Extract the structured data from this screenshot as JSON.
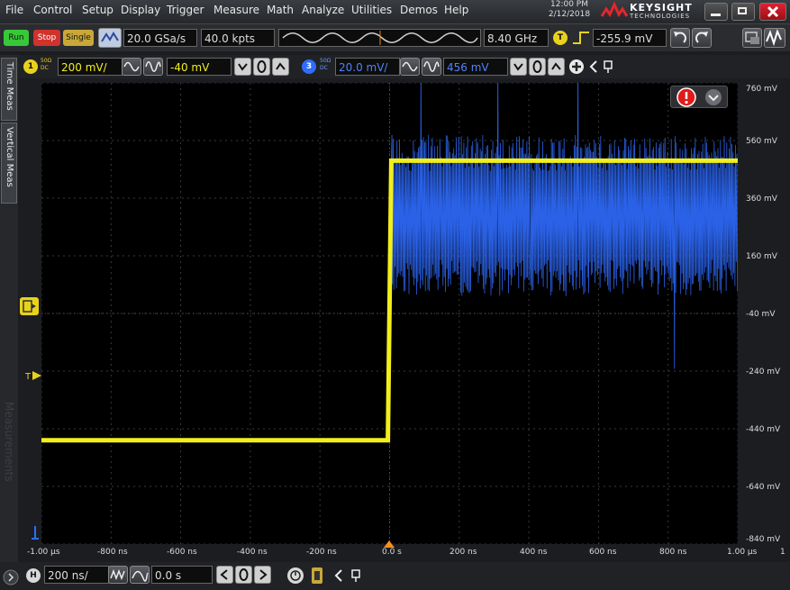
{
  "menu": [
    "File",
    "Control",
    "Setup",
    "Display",
    "Trigger",
    "Measure",
    "Math",
    "Analyze",
    "Utilities",
    "Demos",
    "Help"
  ],
  "datetime": {
    "time": "12:00 PM",
    "date": "2/12/2018"
  },
  "brand": {
    "name": "KEYSIGHT",
    "sub": "TECHNOLOGIES"
  },
  "acquisition": {
    "run": "Run",
    "stop": "Stop",
    "single": "Single",
    "sample_rate": "20.0 GSa/s",
    "memory_depth": "40.0 kpts",
    "bandwidth": "8.40 GHz",
    "trigger_badge": "T",
    "trigger_level": "-255.9 mV"
  },
  "channel1": {
    "number": "1",
    "coupling": "50Ω\nDC",
    "scale": "200 mV/",
    "offset": "-40 mV"
  },
  "channel3": {
    "number": "3",
    "coupling": "50Ω\nDC",
    "scale": "20.0 mV/",
    "offset": "456 mV"
  },
  "left_tabs": [
    "Time Meas",
    "Vertical Meas"
  ],
  "watermark": "Measurements",
  "y_axis_labels": [
    "760 mV",
    "560 mV",
    "360 mV",
    "160 mV",
    "-40 mV",
    "-240 mV",
    "-440 mV",
    "-640 mV",
    "-840 mV"
  ],
  "x_axis_labels": [
    "-1.00 µs",
    "-800 ns",
    "-600 ns",
    "-400 ns",
    "-200 ns",
    "0.0 s",
    "200 ns",
    "400 ns",
    "600 ns",
    "800 ns",
    "1.00 µs"
  ],
  "x_axis_end": "1",
  "timebase": {
    "badge": "H",
    "scale": "200 ns/",
    "position": "0.0 s"
  },
  "colors": {
    "ch1": "#f2ee1c",
    "ch3": "#2f6cff",
    "grid": "#3a3a3a",
    "trigger": "#ff8c1a",
    "alert": "#e01b1b"
  },
  "chart_data": {
    "type": "line",
    "x_unit": "ns",
    "y_unit": "mV",
    "xlim": [
      -1000,
      1000
    ],
    "ylim": [
      -840,
      760
    ],
    "series": [
      {
        "name": "1",
        "type": "step",
        "x": [
          -1000,
          -5,
          5,
          1000
        ],
        "y": [
          -480,
          -480,
          490,
          490
        ]
      },
      {
        "name": "3",
        "type": "noise-burst",
        "start": 5,
        "end": 1000,
        "center": 300,
        "amplitude": 280,
        "range": [
          -170,
          520
        ]
      }
    ]
  }
}
